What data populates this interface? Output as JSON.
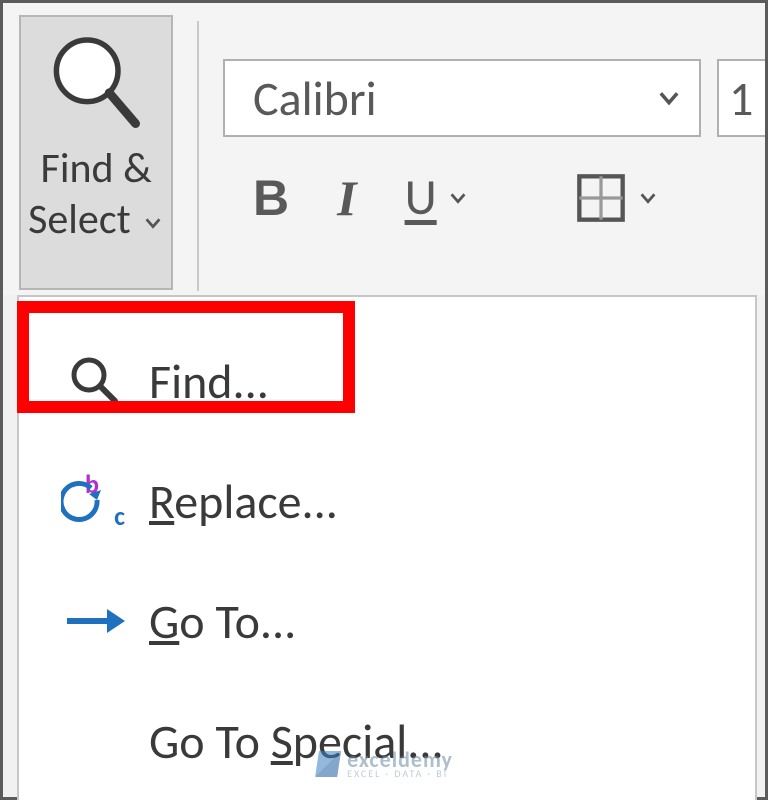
{
  "ribbon": {
    "find_select": {
      "line1": "Find &",
      "line2": "Select"
    },
    "font_name": "Calibri",
    "font_size_partial": "1",
    "bold": "B",
    "italic": "I",
    "underline": "U"
  },
  "menu": {
    "find": "ind...",
    "find_mnemonic": "F",
    "replace": "eplace...",
    "replace_mnemonic": "R",
    "goto": "o To...",
    "goto_mnemonic": "G",
    "special_pre": "Go To ",
    "special_mnemonic": "S",
    "special_post": "pecial..."
  },
  "watermark": {
    "main": "exceldemy",
    "sub": "EXCEL · DATA · BI"
  },
  "colors": {
    "highlight": "#ff0000",
    "accent_blue": "#2070c0",
    "accent_purple": "#b030d0"
  }
}
